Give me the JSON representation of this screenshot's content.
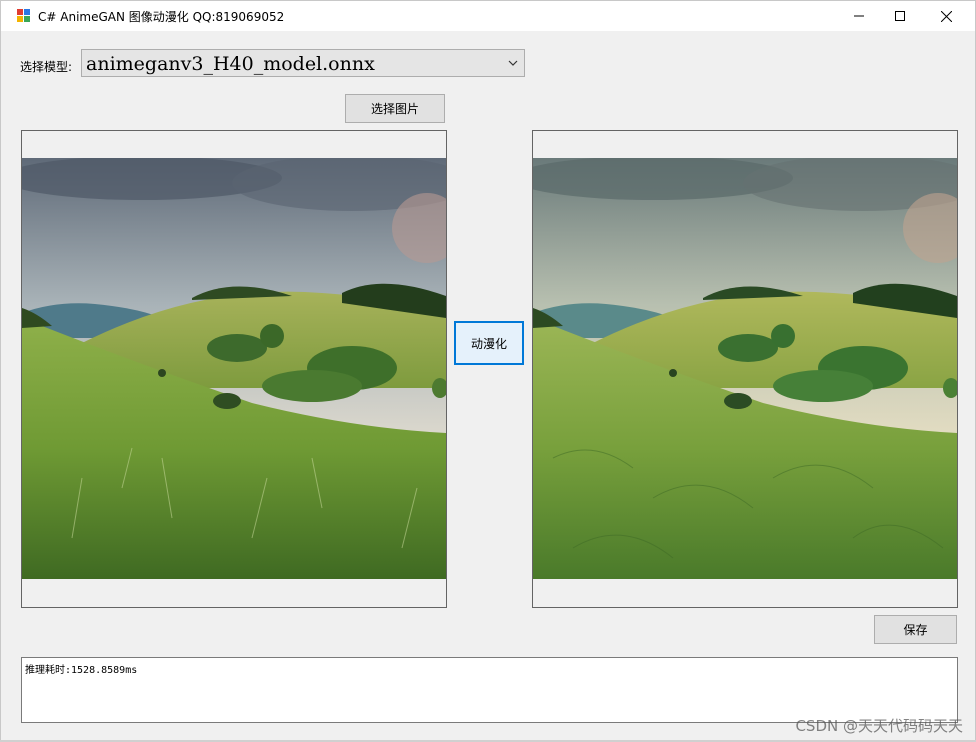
{
  "window": {
    "title": "C# AnimeGAN 图像动漫化 QQ:819069052",
    "minimize_glyph": "—",
    "maximize_glyph": "☐",
    "close_glyph": "✕"
  },
  "model": {
    "label": "选择模型:",
    "selected": "animeganv3_H40_model.onnx"
  },
  "buttons": {
    "select_image": "选择图片",
    "animate": "动漫化",
    "save": "保存"
  },
  "images": {
    "original": "grassy-hills-landscape-photo",
    "result": "grassy-hills-landscape-anime"
  },
  "log": {
    "text": "推理耗时:1528.8589ms"
  },
  "watermark": "CSDN @天天代码码天天",
  "colors": {
    "focus_border": "#0078d7",
    "button_face": "#e1e1e1",
    "window_bg": "#f0f0f0"
  }
}
